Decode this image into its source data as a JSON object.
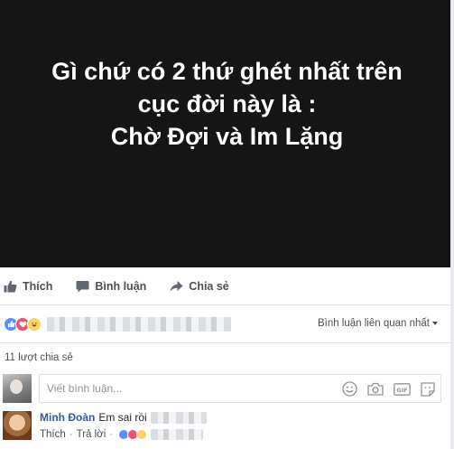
{
  "post": {
    "caption_lines": [
      "Gì chứ có 2 thứ ghét nhất trên",
      "cục đời này là :",
      "Chờ Đợi và Im Lặng"
    ],
    "image_bg": "#151515"
  },
  "actions": {
    "like_label": "Thích",
    "comment_label": "Bình luận",
    "share_label": "Chia sẻ"
  },
  "reactions": {
    "types": [
      "like",
      "love",
      "haha"
    ],
    "sort_label": "Bình luận liên quan nhất"
  },
  "shares_label": "11 lượt chia sẻ",
  "composer": {
    "placeholder": "Viết bình luận...",
    "icons": [
      "emoji-icon",
      "camera-icon",
      "gif-icon",
      "sticker-icon"
    ]
  },
  "comments": [
    {
      "author": "Minh Đoàn",
      "text": "Em sai rồi",
      "like_label": "Thích",
      "reply_label": "Trả lời"
    }
  ],
  "colors": {
    "link": "#365899",
    "like": "#5890ff",
    "love": "#f25268",
    "haha": "#fcd361",
    "muted": "#90949c"
  }
}
